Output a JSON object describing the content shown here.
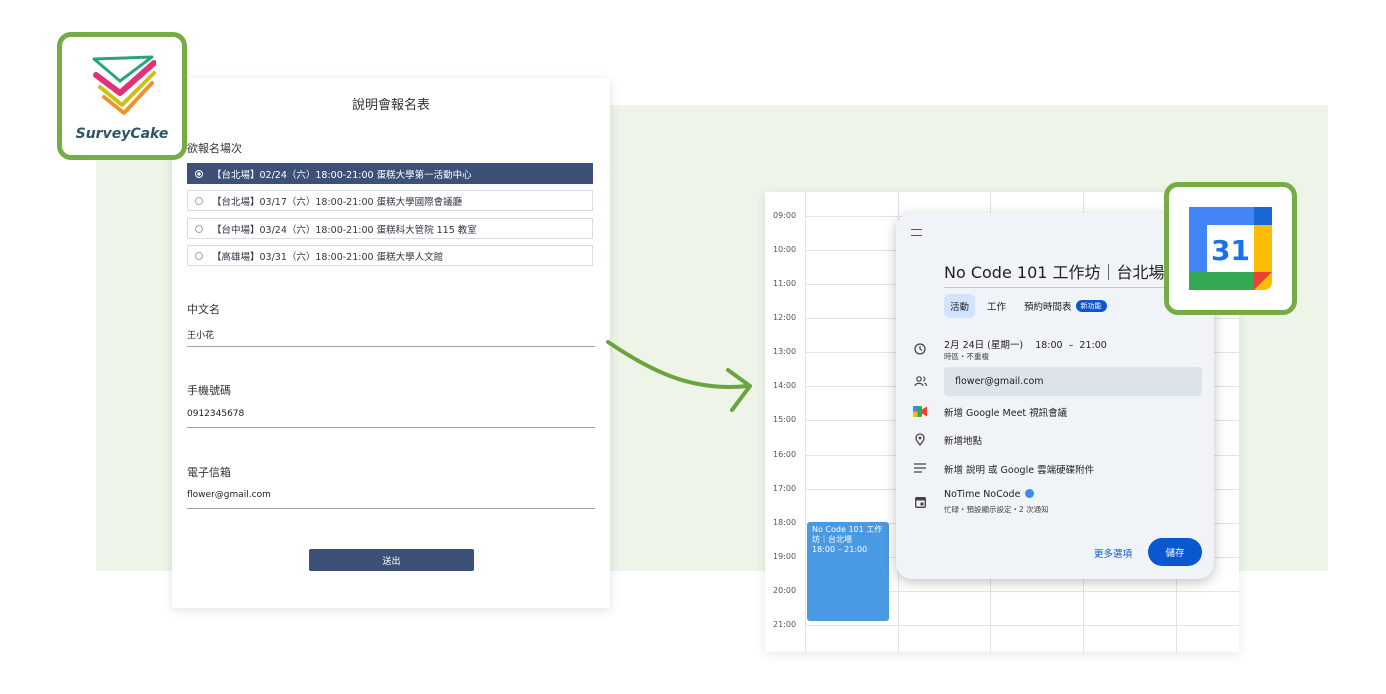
{
  "surveycake": {
    "brand": "SurveyCake"
  },
  "form": {
    "title": "說明會報名表",
    "session_question": "欲報名場次",
    "options": [
      {
        "label": "【台北場】02/24（六）18:00-21:00 蛋糕大學第一活動中心",
        "selected": true
      },
      {
        "label": "【台北場】03/17（六）18:00-21:00 蛋糕大學國際會議廳",
        "selected": false
      },
      {
        "label": "【台中場】03/24（六）18:00-21:00 蛋糕科大管院 115 教室",
        "selected": false
      },
      {
        "label": "【高雄場】03/31（六）18:00-21:00 蛋糕大學人文館",
        "selected": false
      }
    ],
    "fields": [
      {
        "label": "中文名",
        "value": "王小花"
      },
      {
        "label": "手機號碼",
        "value": "0912345678"
      },
      {
        "label": "電子信箱",
        "value": "flower@gmail.com"
      }
    ],
    "submit_label": "送出"
  },
  "calendar": {
    "logo_number": "31",
    "times": [
      "09:00",
      "10:00",
      "11:00",
      "12:00",
      "13:00",
      "14:00",
      "15:00",
      "16:00",
      "17:00",
      "18:00",
      "19:00",
      "20:00",
      "21:00"
    ],
    "event_block": {
      "title": "No Code 101 工作坊｜台北場",
      "time": "18:00 – 21:00"
    },
    "popup": {
      "title": "No Code 101 工作坊｜台北場",
      "tabs": [
        "活動",
        "工作",
        "預約時間表"
      ],
      "new_badge": "新功能",
      "date": "2月 24日 (星期一)",
      "start": "18:00",
      "dash": "–",
      "end": "21:00",
      "tz_note": "時區・不重複",
      "guest": "flower@gmail.com",
      "meet": "新增 Google Meet 視訊會議",
      "location": "新增地點",
      "description": "新增 說明 或 Google 雲端硬碟附件",
      "calendar_name": "NoTime NoCode",
      "calendar_note": "忙碌・預設顯示設定・2 次通知",
      "more_options": "更多選項",
      "save": "儲存"
    }
  },
  "colors": {
    "accent_green": "#74ad44",
    "form_navy": "#3c5078",
    "gcal_blue": "#0b57d0",
    "event_blue": "#4a99e3"
  }
}
